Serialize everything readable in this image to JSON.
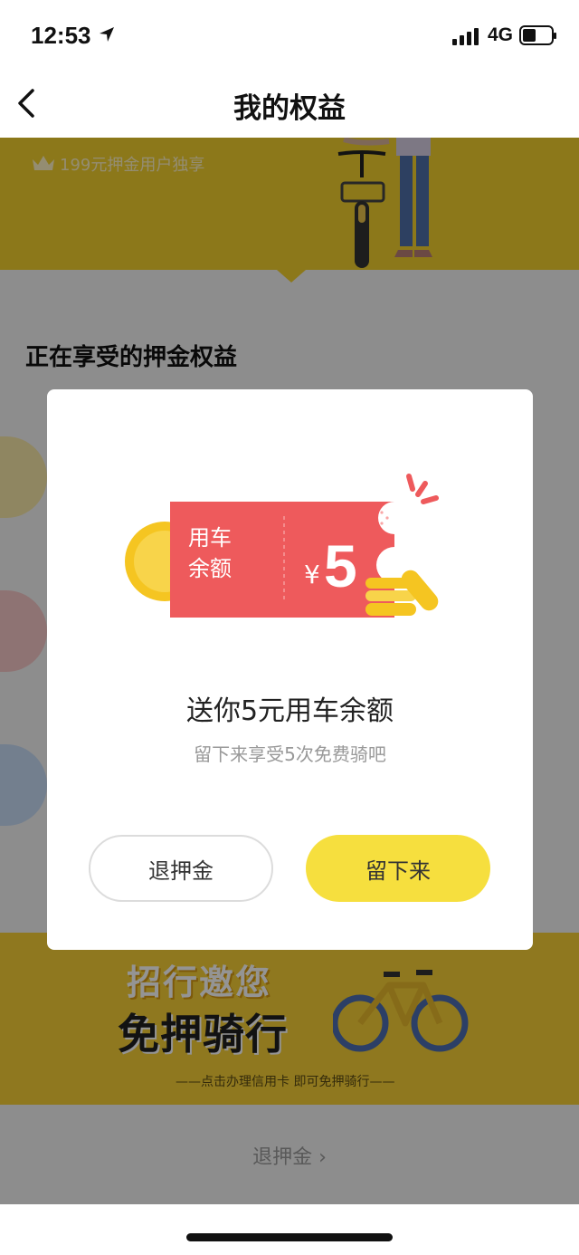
{
  "status_bar": {
    "time": "12:53",
    "network": "4G"
  },
  "nav": {
    "title": "我的权益"
  },
  "banner": {
    "text": "199元押金用户独享"
  },
  "section": {
    "title": "正在享受的押金权益"
  },
  "promo": {
    "title_line1": "招行邀您",
    "title_line2": "免押骑行",
    "subtitle": "——点击办理信用卡 即可免押骑行——"
  },
  "bottom_link": {
    "label": "退押金 ›"
  },
  "modal": {
    "coupon": {
      "label_line1": "用车",
      "label_line2": "余额",
      "currency": "¥",
      "amount": "5"
    },
    "title": "送你5元用车余额",
    "subtitle": "留下来享受5次免费骑吧",
    "refund_button": "退押金",
    "stay_button": "留下来"
  },
  "colors": {
    "accent_yellow": "#f6df3e",
    "coupon_red": "#ee5a5c",
    "coin_gold": "#f5c521"
  }
}
